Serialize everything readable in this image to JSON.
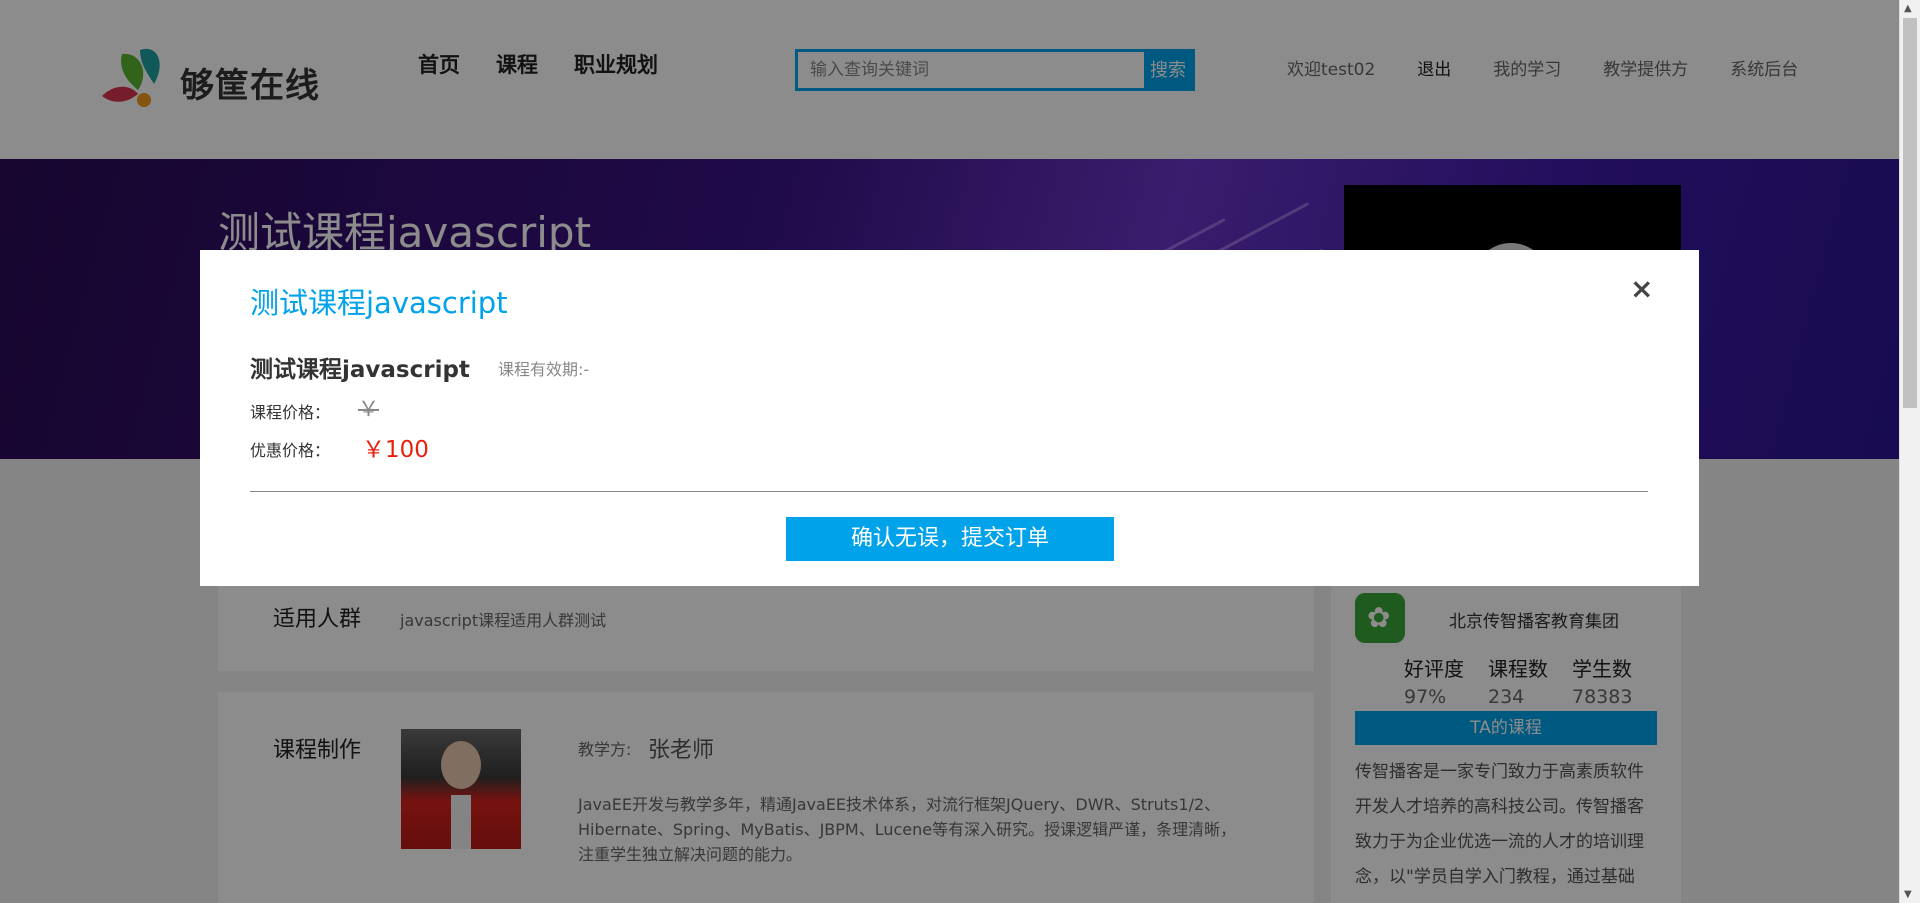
{
  "header": {
    "logo_text": "够筐在线",
    "nav": [
      "首页",
      "课程",
      "职业规划"
    ],
    "search_placeholder": "输入查询关键词",
    "search_button": "搜索",
    "welcome": "欢迎test02",
    "logout": "退出",
    "my_learning": "我的学习",
    "teaching_provider": "教学提供方",
    "admin": "系统后台"
  },
  "banner": {
    "course_title": "测试课程javascript"
  },
  "audience": {
    "title": "适用人群",
    "text": "javascript课程适用人群测试"
  },
  "production": {
    "title": "课程制作",
    "teacher_label": "教学方:",
    "teacher_name": "张老师",
    "teacher_desc_line1": "JavaEE开发与教学多年，精通JavaEE技术体系，对流行框架JQuery、DWR、Struts1/2、",
    "teacher_desc_line2": "Hibernate、Spring、MyBatis、JBPM、Lucene等有深入研究。授课逻辑严谨，条理清晰，",
    "teacher_desc_line3": "注重学生独立解决问题的能力。"
  },
  "organization": {
    "name": "北京传智播客教育集团",
    "stats": [
      {
        "label": "好评度",
        "value": "97%"
      },
      {
        "label": "课程数",
        "value": "234"
      },
      {
        "label": "学生数",
        "value": "78383"
      }
    ],
    "ta_courses_button": "TA的课程",
    "description": "传智播客是一家专门致力于高素质软件开发人才培养的高科技公司。传智播客致力于为企业优选一流的人才的培训理念，以\"学员自学入门教程，通过基础"
  },
  "modal": {
    "title": "测试课程javascript",
    "close": "×",
    "course_name": "测试课程javascript",
    "validity": "课程有效期:-",
    "price_label": "课程价格：",
    "price_value": "￥",
    "discount_label": "优惠价格：",
    "discount_value": "￥100",
    "submit_button": "确认无误，提交订单"
  },
  "colors": {
    "accent": "#00a2ea",
    "price_red": "#e8210e"
  }
}
